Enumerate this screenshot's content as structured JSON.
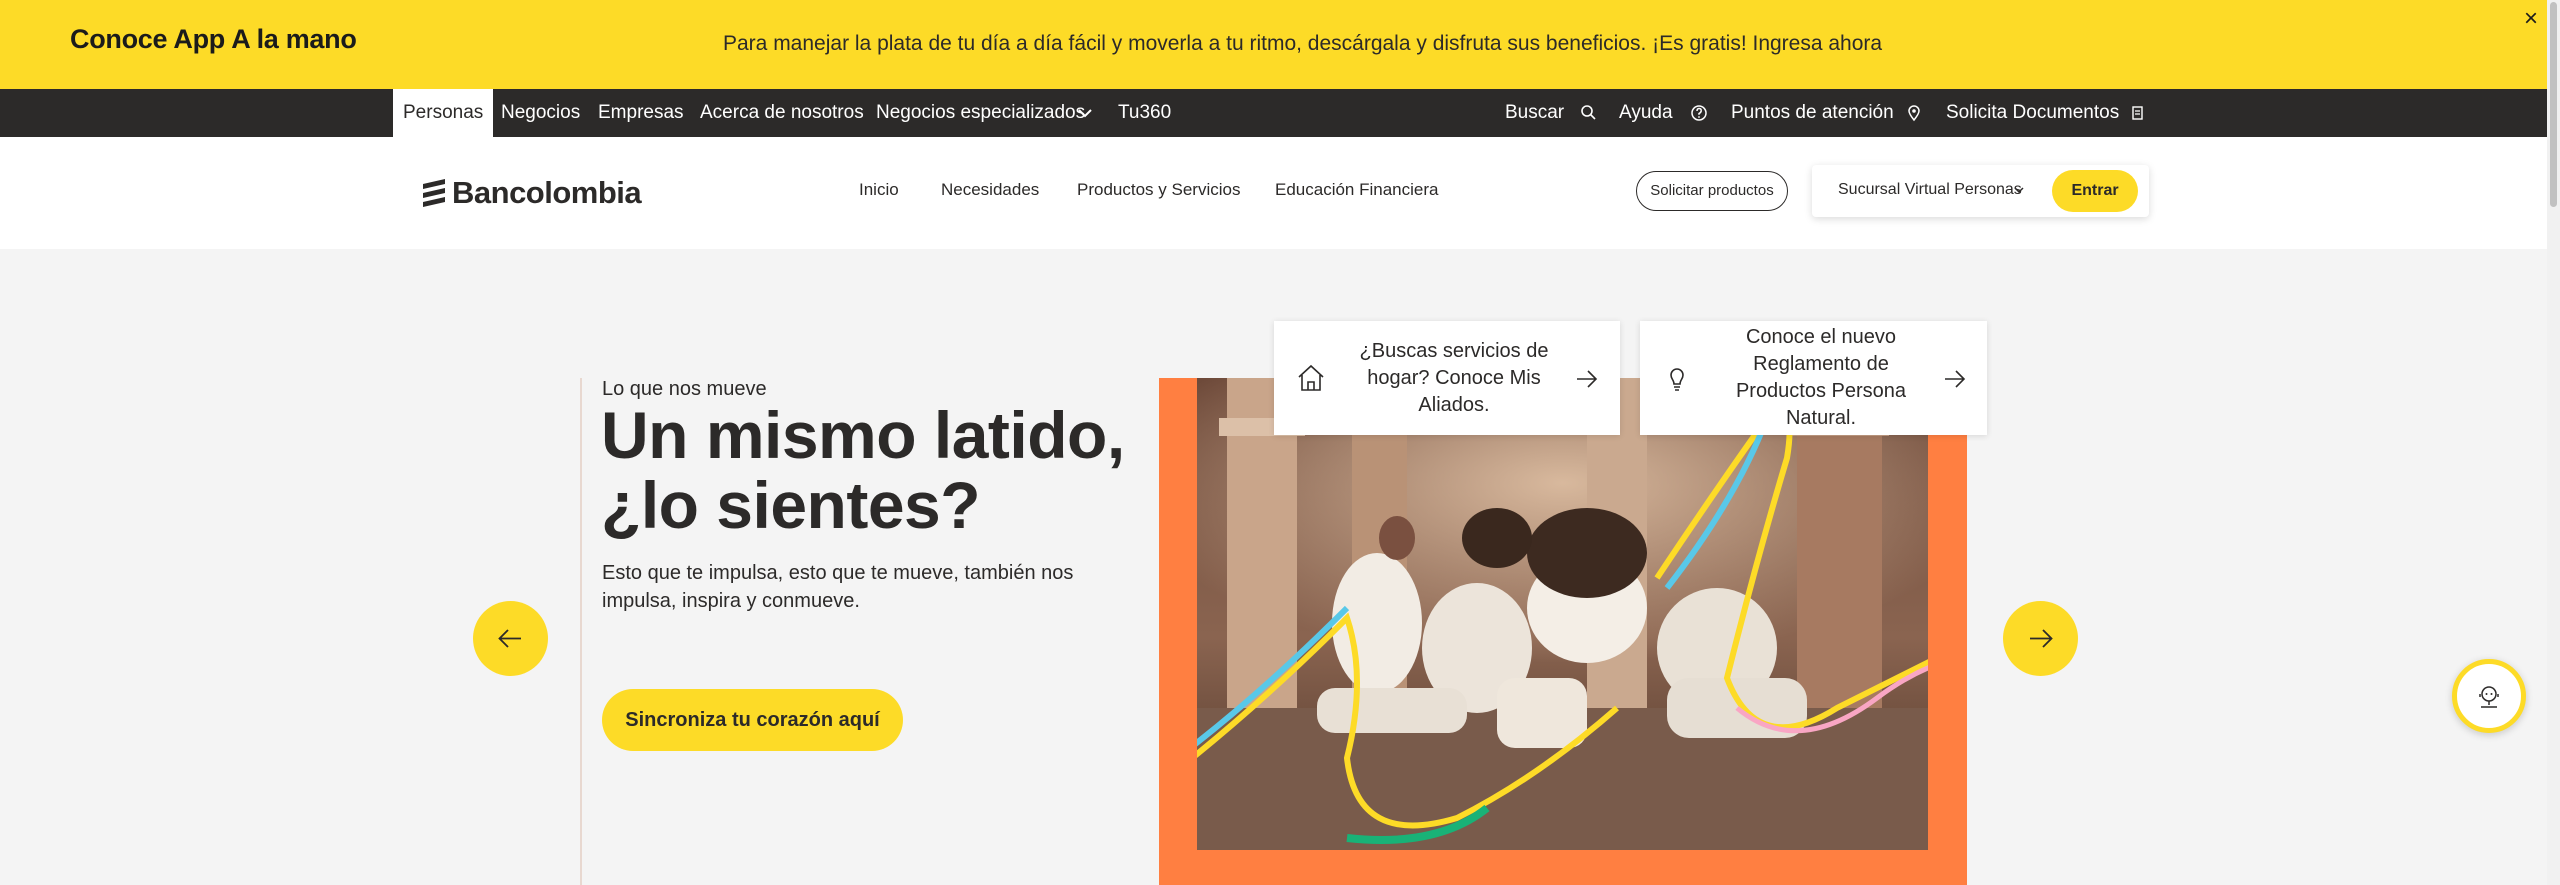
{
  "promo": {
    "title": "Conoce App A la mano",
    "text": "Para manejar la plata de tu día a día fácil y moverla a tu ritmo, descárgala y disfruta sus beneficios.  ¡Es gratis! Ingresa ahora",
    "close": "×"
  },
  "topnav": {
    "items": [
      "Personas",
      "Negocios",
      "Empresas",
      "Acerca de nosotros",
      "Negocios especializados",
      "Tu360"
    ],
    "right": [
      "Buscar",
      "Ayuda",
      "Puntos de atención",
      "Solicita Documentos"
    ]
  },
  "header": {
    "logo": "Bancolombia",
    "nav": [
      "Inicio",
      "Necesidades",
      "Productos y Servicios",
      "Educación Financiera"
    ],
    "solicitar": "Solicitar productos",
    "sucursal": "Sucursal Virtual Personas",
    "entrar": "Entrar"
  },
  "hero": {
    "eyebrow": "Lo que nos mueve",
    "title": "Un mismo latido, ¿lo sientes?",
    "description": "Esto que te impulsa, esto que te mueve, también nos impulsa, inspira y conmueve.",
    "cta": "Sincroniza tu corazón aquí"
  },
  "cards": [
    {
      "text": "¿Buscas servicios de hogar? Conoce Mis Aliados.",
      "icon": "house-icon"
    },
    {
      "text": "Conoce el nuevo Reglamento de Productos Persona Natural.",
      "icon": "lightbulb-icon"
    }
  ],
  "colors": {
    "brand_yellow": "#fddb27",
    "dark": "#2c2a29",
    "photo_orange": "#ff7f41"
  }
}
